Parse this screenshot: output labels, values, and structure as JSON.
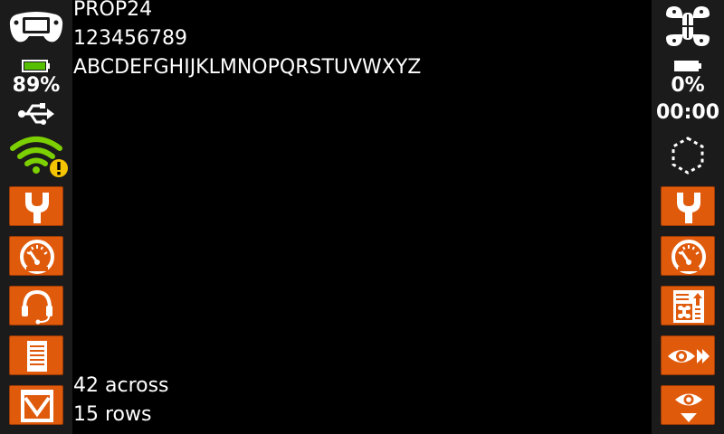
{
  "status": {
    "radio_battery_pct": "89%",
    "model_battery_pct": "0%",
    "timer": "00:00"
  },
  "main": {
    "lines": [
      "PROP24",
      "123456789",
      "ABCDEFGHIJKLMNOPQRSTUVWXYZ",
      "42 across",
      "15 rows"
    ]
  },
  "colors": {
    "accent": "#e05a0c",
    "battery_green": "#56c000",
    "wifi_green": "#7ccf00",
    "warning_yellow": "#f5c400",
    "sidebar_bg": "#1b1b1b",
    "background": "#000000"
  },
  "icons": {
    "left": [
      "radio-transmitter-icon",
      "battery-icon",
      "usb-icon",
      "wifi-warning-icon",
      "wrench-icon",
      "gauge-icon",
      "headset-icon",
      "document-icon",
      "inbox-icon"
    ],
    "right": [
      "quadcopter-model-icon",
      "battery-icon",
      "dashed-hexagon-icon",
      "wrench-icon",
      "gauge-icon",
      "model-setup-icon",
      "eye-forward-icon",
      "eye-down-icon"
    ]
  }
}
